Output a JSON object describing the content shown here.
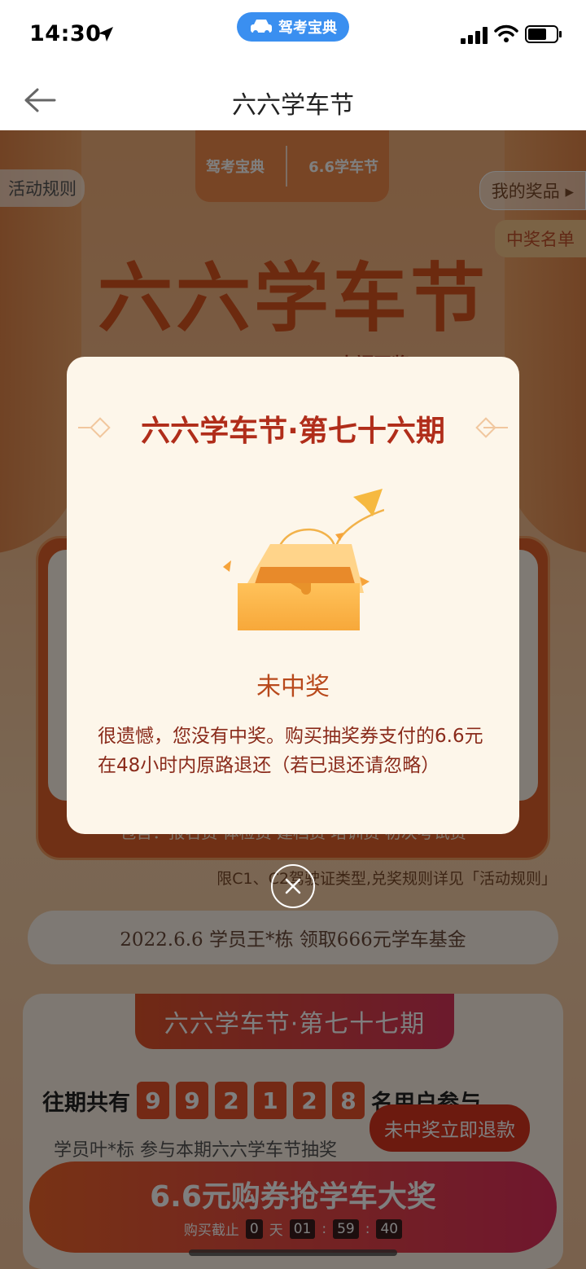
{
  "status_bar": {
    "time": "14:30",
    "app_pill_label": "驾考宝典"
  },
  "nav": {
    "title": "六六学车节"
  },
  "background_page": {
    "logo_left_text": "驾考宝典",
    "logo_right_text": "6.6学车节",
    "rules_label": "活动规则",
    "my_prizes_label": "我的奖品",
    "winners_label": "中奖名单",
    "hero_title": "六六学车节",
    "hero_sub": "幸福开奖",
    "card_footer": "包含：报名费 体检费 建档费 培训费 初次考试费",
    "limit_note": "限C1、C2驾驶证类型,兑奖规则详见「活动规则」",
    "ticker_text": "2022.6.6  学员王*栋  领取666元学车基金",
    "period_tab": "六六学车节·第七十七期",
    "participants_prefix": "往期共有",
    "participant_digits": [
      "9",
      "9",
      "2",
      "1",
      "2",
      "8"
    ],
    "participants_suffix": "名用户参与",
    "user_activity": "学员叶*标 参与本期六六学车节抽奖",
    "refund_bubble": "未中奖立即退款",
    "buy_button_label": "6.6元购券抢学车大奖",
    "countdown": {
      "prefix": "购买截止",
      "days": "0",
      "day_unit": "天",
      "hours": "01",
      "minutes": "59",
      "seconds": "40"
    }
  },
  "modal": {
    "title": "六六学车节·第七十六期",
    "result_title": "未中奖",
    "result_message": "很遗憾，您没有中奖。购买抽奖券支付的6.6元在48小时内原路退还（若已退还请忽略）"
  },
  "colors": {
    "accent": "#b02d1a",
    "overlay": "rgba(0,0,0,0.5)",
    "pill": "#3a8ff0"
  }
}
